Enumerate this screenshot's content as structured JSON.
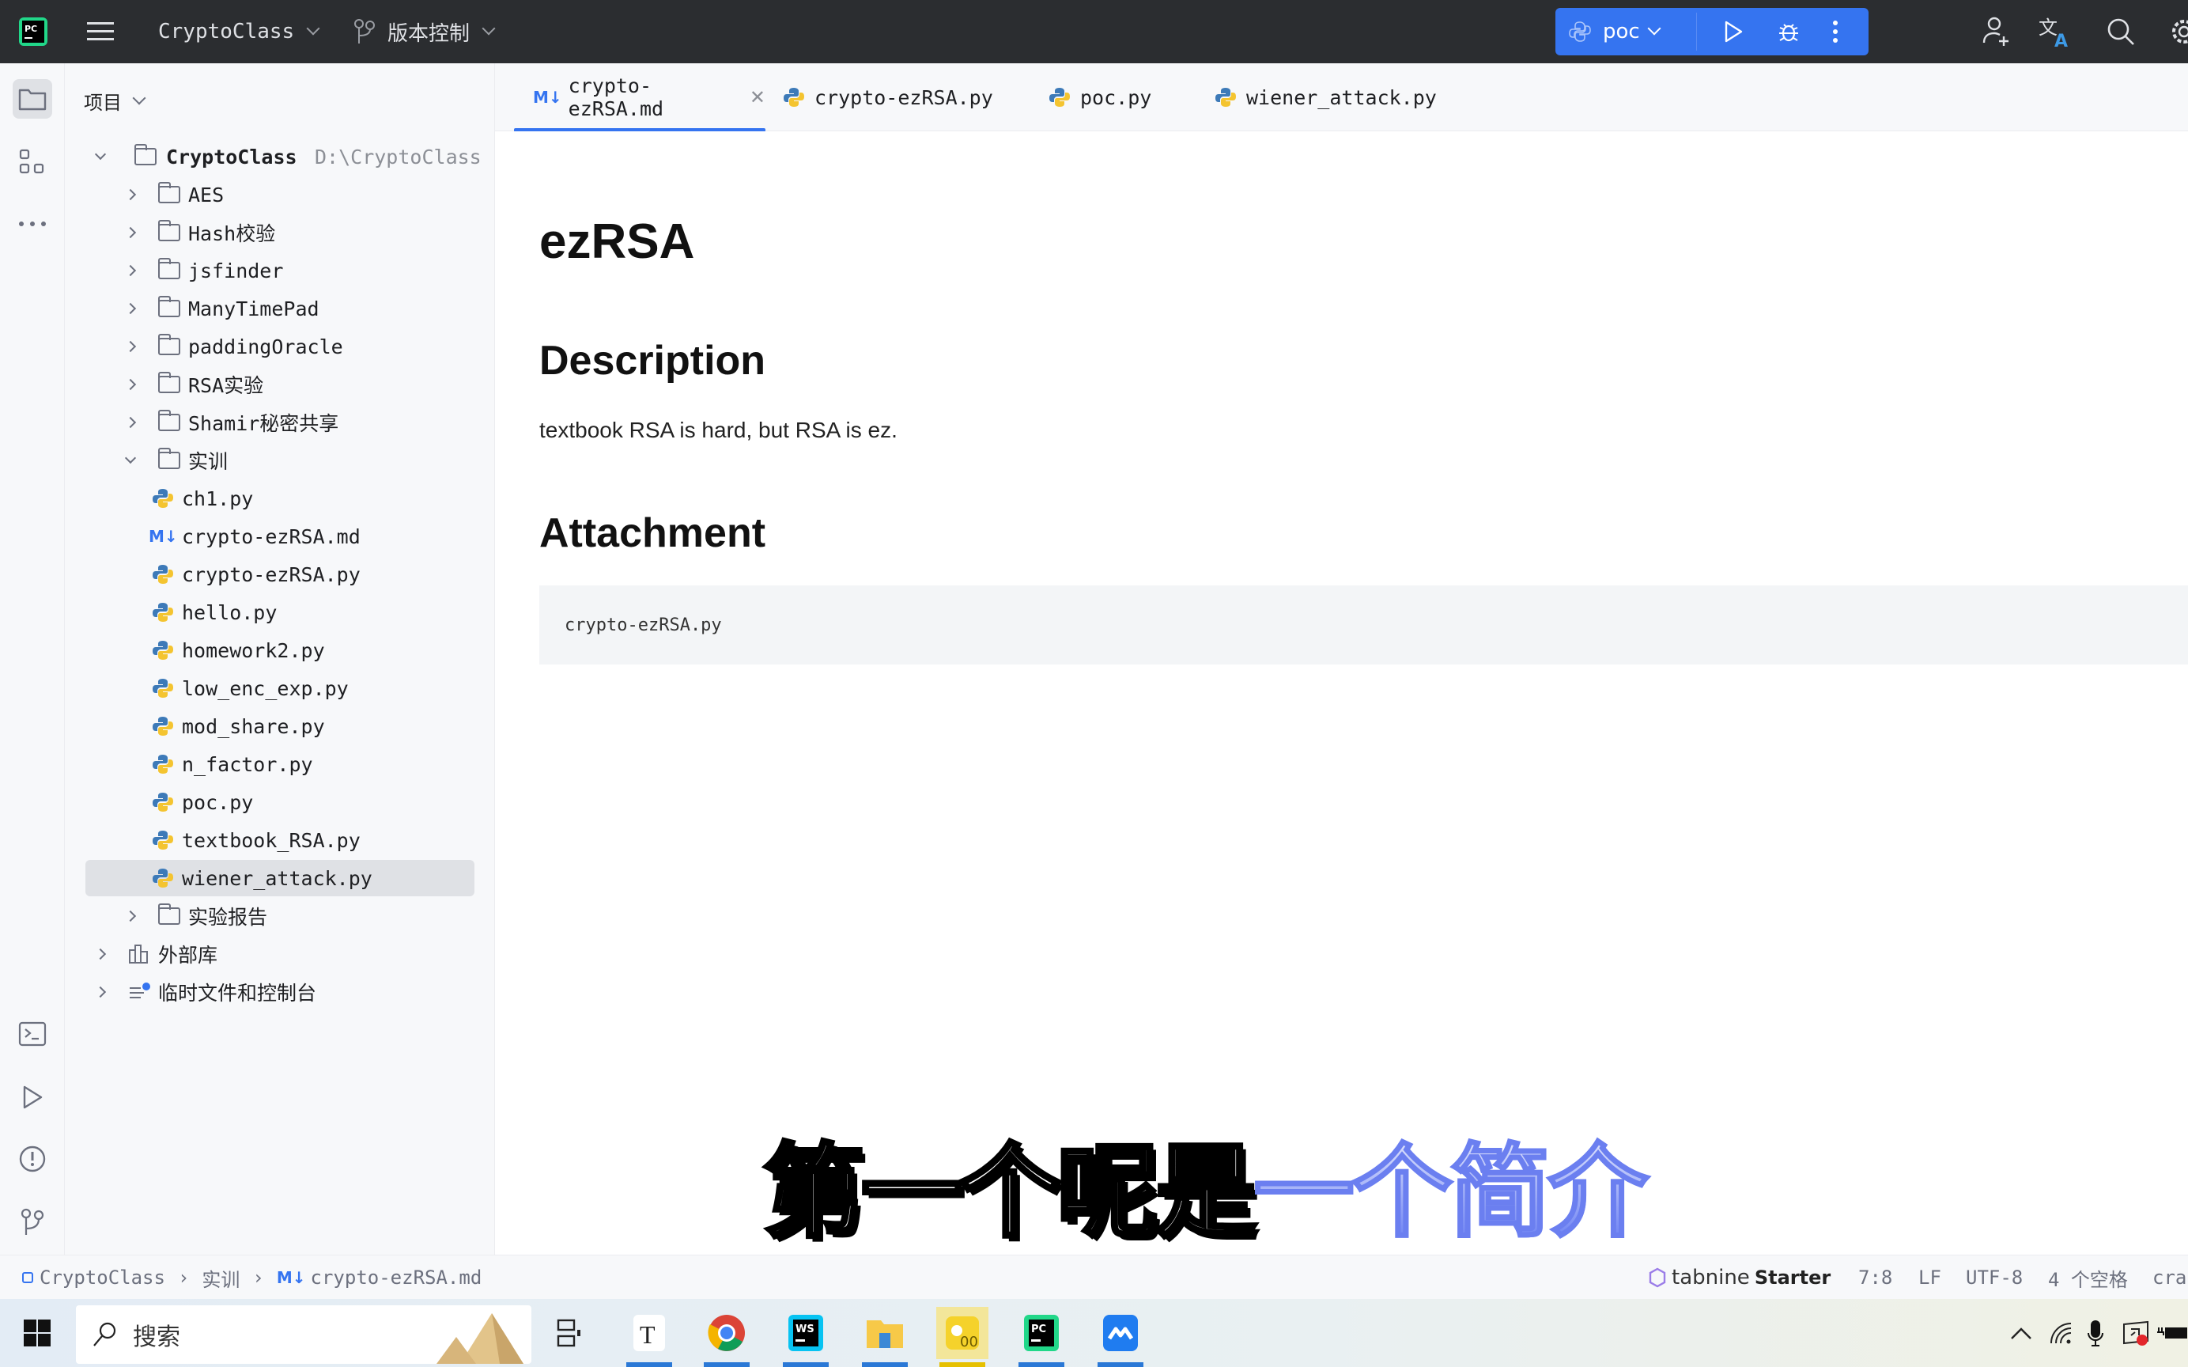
{
  "titlebar": {
    "project_name": "CryptoClass",
    "vcs_label": "版本控制",
    "run_config": "poc",
    "icons": [
      "pycharm-logo-icon",
      "hamburger-menu-icon",
      "vcs-branch-icon",
      "python-icon",
      "run-icon",
      "debug-icon",
      "more-icon",
      "add-user-icon",
      "translate-icon",
      "search-icon",
      "settings-icon"
    ]
  },
  "colors": {
    "accent": "#3574f0",
    "titlebar_bg": "#2b2d30",
    "panel_bg": "#f7f8fa",
    "selection_bg": "#dfe1e5"
  },
  "project_panel": {
    "header": "项目",
    "root": {
      "name": "CryptoClass",
      "path": "D:\\CryptoClass"
    },
    "items": [
      {
        "name": "AES",
        "type": "folder",
        "expanded": false
      },
      {
        "name": "Hash校验",
        "type": "folder",
        "expanded": false
      },
      {
        "name": "jsfinder",
        "type": "folder",
        "expanded": false
      },
      {
        "name": "ManyTimePad",
        "type": "folder",
        "expanded": false
      },
      {
        "name": "paddingOracle",
        "type": "folder",
        "expanded": false
      },
      {
        "name": "RSA实验",
        "type": "folder",
        "expanded": false
      },
      {
        "name": "Shamir秘密共享",
        "type": "folder",
        "expanded": false
      },
      {
        "name": "实训",
        "type": "folder",
        "expanded": true
      },
      {
        "name": "ch1.py",
        "type": "python"
      },
      {
        "name": "crypto-ezRSA.md",
        "type": "markdown"
      },
      {
        "name": "crypto-ezRSA.py",
        "type": "python"
      },
      {
        "name": "hello.py",
        "type": "python"
      },
      {
        "name": "homework2.py",
        "type": "python"
      },
      {
        "name": "low_enc_exp.py",
        "type": "python"
      },
      {
        "name": "mod_share.py",
        "type": "python"
      },
      {
        "name": "n_factor.py",
        "type": "python"
      },
      {
        "name": "poc.py",
        "type": "python"
      },
      {
        "name": "textbook_RSA.py",
        "type": "python"
      },
      {
        "name": "wiener_attack.py",
        "type": "python",
        "selected": true
      },
      {
        "name": "实验报告",
        "type": "folder",
        "expanded": false
      },
      {
        "name": "外部库",
        "type": "library"
      },
      {
        "name": "临时文件和控制台",
        "type": "scratches"
      }
    ]
  },
  "tabs": [
    {
      "label": "crypto-ezRSA.md",
      "type": "markdown",
      "active": true
    },
    {
      "label": "crypto-ezRSA.py",
      "type": "python"
    },
    {
      "label": "poc.py",
      "type": "python"
    },
    {
      "label": "wiener_attack.py",
      "type": "python"
    }
  ],
  "document": {
    "title": "ezRSA",
    "h_description": "Description",
    "description": "textbook RSA is hard, but RSA is ez.",
    "h_attachment": "Attachment",
    "attachment_code": "crypto-ezRSA.py"
  },
  "subtitle": {
    "part1": "第一个呢是",
    "part2": "一个简介"
  },
  "statusbar": {
    "breadcrumb": [
      "CryptoClass",
      "实训",
      "crypto-ezRSA.md"
    ],
    "tabnine_brand": "tabnine",
    "tabnine_plan": "Starter",
    "cursor_position": "7:8",
    "line_ending": "LF",
    "encoding": "UTF-8",
    "indent": "4 个空格",
    "truncated": "cra"
  },
  "taskbar": {
    "search_placeholder": "搜索",
    "apps": [
      "start-icon",
      "task-view-icon",
      "typora-icon",
      "chrome-icon",
      "webstorm-icon",
      "file-explorer-icon",
      "audio-app-icon",
      "pycharm-icon",
      "feishu-icon"
    ]
  }
}
